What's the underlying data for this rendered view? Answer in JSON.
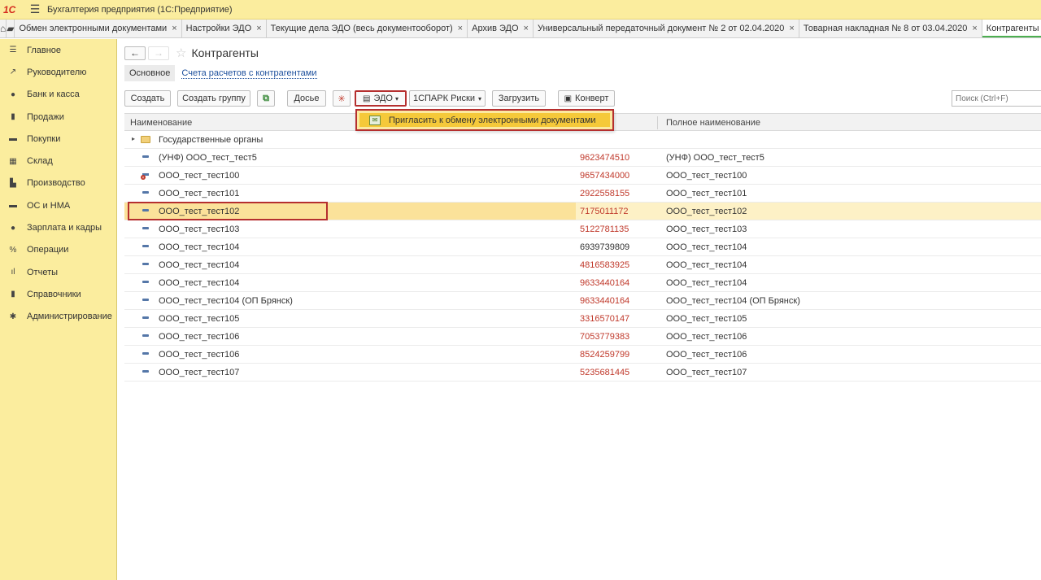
{
  "app": {
    "logo": "1С",
    "title": "Бухгалтерия предприятия  (1С:Предприятие)"
  },
  "tabs": [
    {
      "label": "Обмен электронными документами"
    },
    {
      "label": "Настройки ЭДО"
    },
    {
      "label": "Текущие дела ЭДО (весь документооборот)"
    },
    {
      "label": "Архив ЭДО"
    },
    {
      "label": "Универсальный передаточный документ № 2 от 02.04.2020"
    },
    {
      "label": "Товарная накладная № 8 от 03.04.2020"
    },
    {
      "label": "Контрагенты"
    }
  ],
  "sidebar": {
    "items": [
      {
        "label": "Главное",
        "icon": "menu-icon"
      },
      {
        "label": "Руководителю",
        "icon": "trend-icon"
      },
      {
        "label": "Банк и касса",
        "icon": "coin-icon"
      },
      {
        "label": "Продажи",
        "icon": "bag-icon"
      },
      {
        "label": "Покупки",
        "icon": "cart-icon"
      },
      {
        "label": "Склад",
        "icon": "warehouse-icon"
      },
      {
        "label": "Производство",
        "icon": "factory-icon"
      },
      {
        "label": "ОС и НМА",
        "icon": "truck-icon"
      },
      {
        "label": "Зарплата и кадры",
        "icon": "person-icon"
      },
      {
        "label": "Операции",
        "icon": "operations-icon"
      },
      {
        "label": "Отчеты",
        "icon": "chart-icon"
      },
      {
        "label": "Справочники",
        "icon": "book-icon"
      },
      {
        "label": "Администрирование",
        "icon": "gear-icon"
      }
    ]
  },
  "page": {
    "title": "Контрагенты",
    "subtabs": {
      "main": "Основное",
      "link": "Счета расчетов с контрагентами"
    }
  },
  "toolbar": {
    "create": "Создать",
    "create_group": "Создать группу",
    "dossier": "Досье",
    "edo": "ЭДО",
    "spark": "1СПАРК Риски",
    "load": "Загрузить",
    "envelope": "Конверт",
    "search_placeholder": "Поиск (Ctrl+F)"
  },
  "dropdown": {
    "item": "Пригласить к обмену электронными документами"
  },
  "table": {
    "headers": {
      "name": "Наименование",
      "full_name": "Полное наименование"
    },
    "group_row": "Государственные органы",
    "rows": [
      {
        "name": "(УНФ) ООО_тест_тест5",
        "inn": "9623474510",
        "full": "(УНФ) ООО_тест_тест5",
        "inn_red": true,
        "deleted": false
      },
      {
        "name": "ООО_тест_тест100",
        "inn": "9657434000",
        "full": "ООО_тест_тест100",
        "inn_red": true,
        "deleted": true
      },
      {
        "name": "ООО_тест_тест101",
        "inn": "2922558155",
        "full": "ООО_тест_тест101",
        "inn_red": true,
        "deleted": false
      },
      {
        "name": "ООО_тест_тест102",
        "inn": "7175011172",
        "full": "ООО_тест_тест102",
        "inn_red": true,
        "deleted": false
      },
      {
        "name": "ООО_тест_тест103",
        "inn": "5122781135",
        "full": "ООО_тест_тест103",
        "inn_red": true,
        "deleted": false
      },
      {
        "name": "ООО_тест_тест104",
        "inn": "6939739809",
        "full": "ООО_тест_тест104",
        "inn_red": false,
        "deleted": false
      },
      {
        "name": "ООО_тест_тест104",
        "inn": "4816583925",
        "full": "ООО_тест_тест104",
        "inn_red": true,
        "deleted": false
      },
      {
        "name": "ООО_тест_тест104",
        "inn": "9633440164",
        "full": "ООО_тест_тест104",
        "inn_red": true,
        "deleted": false
      },
      {
        "name": "ООО_тест_тест104 (ОП Брянск)",
        "inn": "9633440164",
        "full": "ООО_тест_тест104 (ОП Брянск)",
        "inn_red": true,
        "deleted": false
      },
      {
        "name": "ООО_тест_тест105",
        "inn": "3316570147",
        "full": "ООО_тест_тест105",
        "inn_red": true,
        "deleted": false
      },
      {
        "name": "ООО_тест_тест106",
        "inn": "7053779383",
        "full": "ООО_тест_тест106",
        "inn_red": true,
        "deleted": false
      },
      {
        "name": "ООО_тест_тест106",
        "inn": "8524259799",
        "full": "ООО_тест_тест106",
        "inn_red": true,
        "deleted": false
      },
      {
        "name": "ООО_тест_тест107",
        "inn": "5235681445",
        "full": "ООО_тест_тест107",
        "inn_red": true,
        "deleted": false
      }
    ],
    "selected_index": 3
  },
  "colors": {
    "sidebar_bg": "#fbed9e",
    "highlight_red": "#b52f2f",
    "inn_red": "#c0392b",
    "link_blue": "#1c4f9c"
  }
}
